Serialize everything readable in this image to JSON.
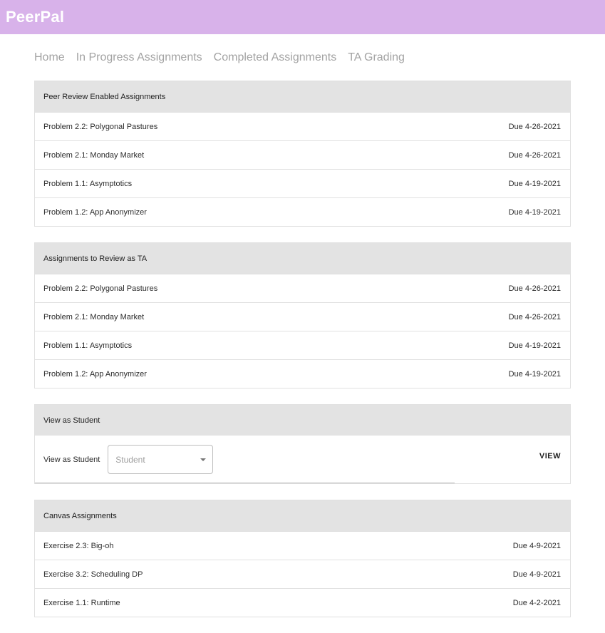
{
  "app": {
    "title": "PeerPal"
  },
  "nav": [
    {
      "label": "Home"
    },
    {
      "label": "In Progress Assignments"
    },
    {
      "label": "Completed Assignments"
    },
    {
      "label": "TA Grading"
    }
  ],
  "peer_review": {
    "header": "Peer Review Enabled Assignments",
    "items": [
      {
        "name": "Problem 2.2: Polygonal Pastures",
        "due": "Due 4-26-2021"
      },
      {
        "name": "Problem 2.1: Monday Market",
        "due": "Due 4-26-2021"
      },
      {
        "name": "Problem 1.1: Asymptotics",
        "due": "Due 4-19-2021"
      },
      {
        "name": "Problem 1.2: App Anonymizer",
        "due": "Due 4-19-2021"
      }
    ]
  },
  "ta_review": {
    "header": "Assignments to Review as TA",
    "items": [
      {
        "name": "Problem 2.2: Polygonal Pastures",
        "due": "Due 4-26-2021"
      },
      {
        "name": "Problem 2.1: Monday Market",
        "due": "Due 4-26-2021"
      },
      {
        "name": "Problem 1.1: Asymptotics",
        "due": "Due 4-19-2021"
      },
      {
        "name": "Problem 1.2: App Anonymizer",
        "due": "Due 4-19-2021"
      }
    ]
  },
  "view_student": {
    "header": "View as Student",
    "label": "View as Student",
    "select_value": "Student",
    "button": "VIEW"
  },
  "canvas": {
    "header": "Canvas Assignments",
    "items": [
      {
        "name": "Exercise 2.3: Big-oh",
        "due": "Due 4-9-2021"
      },
      {
        "name": "Exercise 3.2: Scheduling DP",
        "due": "Due 4-9-2021"
      },
      {
        "name": "Exercise 1.1: Runtime",
        "due": "Due 4-2-2021"
      }
    ]
  },
  "colors": {
    "app_bar": "#d8b2ea",
    "panel_header": "#e3e3e3",
    "nav_text": "#a3a3a3"
  }
}
